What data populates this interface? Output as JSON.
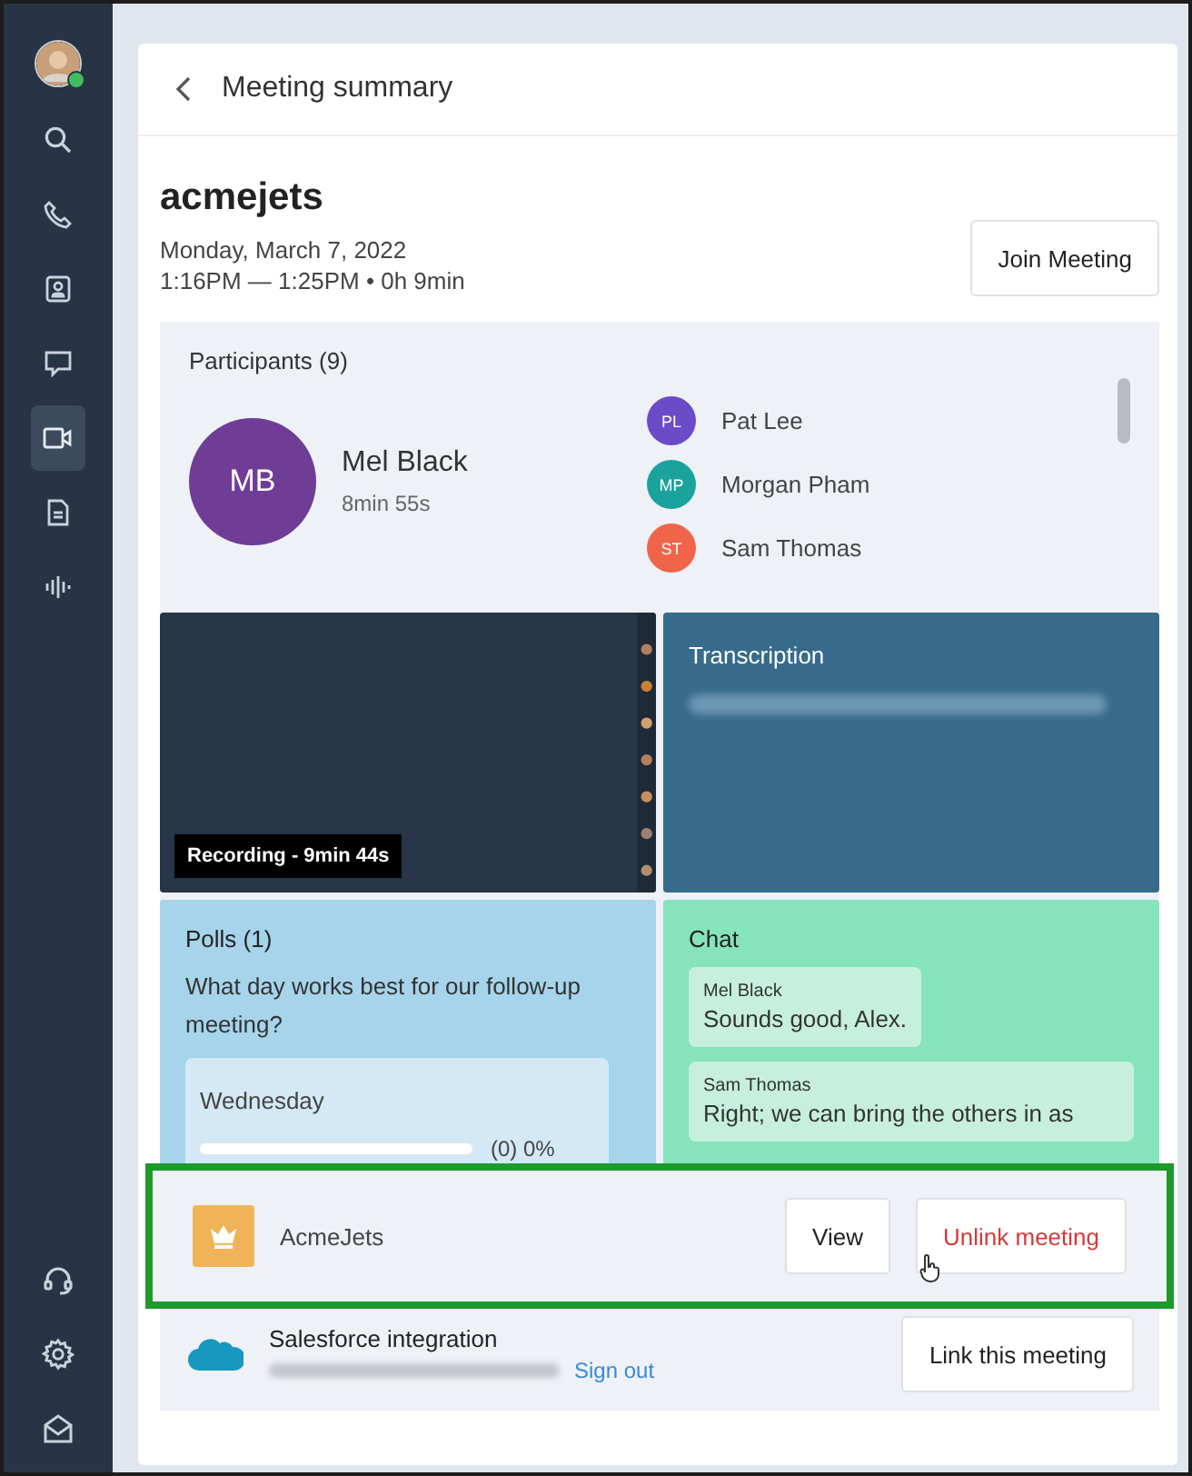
{
  "sidebar": {
    "avatar": {
      "online": true
    },
    "nav": [
      {
        "kind": "search",
        "selected": false
      },
      {
        "kind": "phone",
        "selected": false
      },
      {
        "kind": "contacts",
        "selected": false
      },
      {
        "kind": "chat",
        "selected": false
      },
      {
        "kind": "video",
        "selected": true
      },
      {
        "kind": "document",
        "selected": false
      },
      {
        "kind": "voicemail",
        "selected": false
      }
    ],
    "bottom": [
      {
        "kind": "headset"
      },
      {
        "kind": "settings"
      },
      {
        "kind": "inbox"
      }
    ]
  },
  "header": {
    "title": "Meeting summary"
  },
  "meeting": {
    "title": "acmejets",
    "date": "Monday, March 7, 2022",
    "time": "1:16PM — 1:25PM • 0h 9min",
    "join_button": "Join Meeting"
  },
  "participants": {
    "heading": "Participants (9)",
    "host": {
      "initials": "MB",
      "name": "Mel Black",
      "duration": "8min 55s",
      "color": "#6f3d96"
    },
    "list": [
      {
        "initials": "PL",
        "name": "Pat Lee",
        "color": "#6a4bc8"
      },
      {
        "initials": "MP",
        "name": "Morgan Pham",
        "color": "#1aa39c"
      },
      {
        "initials": "ST",
        "name": "Sam Thomas",
        "color": "#f0644a"
      }
    ]
  },
  "recording": {
    "label": "Recording - 9min 44s"
  },
  "transcription": {
    "heading": "Transcription"
  },
  "polls": {
    "heading": "Polls (1)",
    "question": "What day works best for our follow-up meeting?",
    "options": [
      {
        "label": "Wednesday",
        "level": 0,
        "result": "(0) 0%"
      }
    ]
  },
  "chat": {
    "heading": "Chat",
    "messages": [
      {
        "sender": "Mel Black",
        "text": "Sounds good, Alex."
      },
      {
        "sender": "Sam Thomas",
        "text": "Right; we can bring the others in as"
      }
    ]
  },
  "integrations": [
    {
      "kind": "crm",
      "name": "AcmeJets",
      "highlighted": true,
      "buttons": [
        {
          "label": "View",
          "kind": "default"
        },
        {
          "label": "Unlink meeting",
          "kind": "danger"
        }
      ]
    },
    {
      "kind": "salesforce",
      "name": "Salesforce integration",
      "link": "Sign out",
      "buttons": [
        {
          "label": "Link this meeting",
          "kind": "default"
        }
      ]
    }
  ]
}
